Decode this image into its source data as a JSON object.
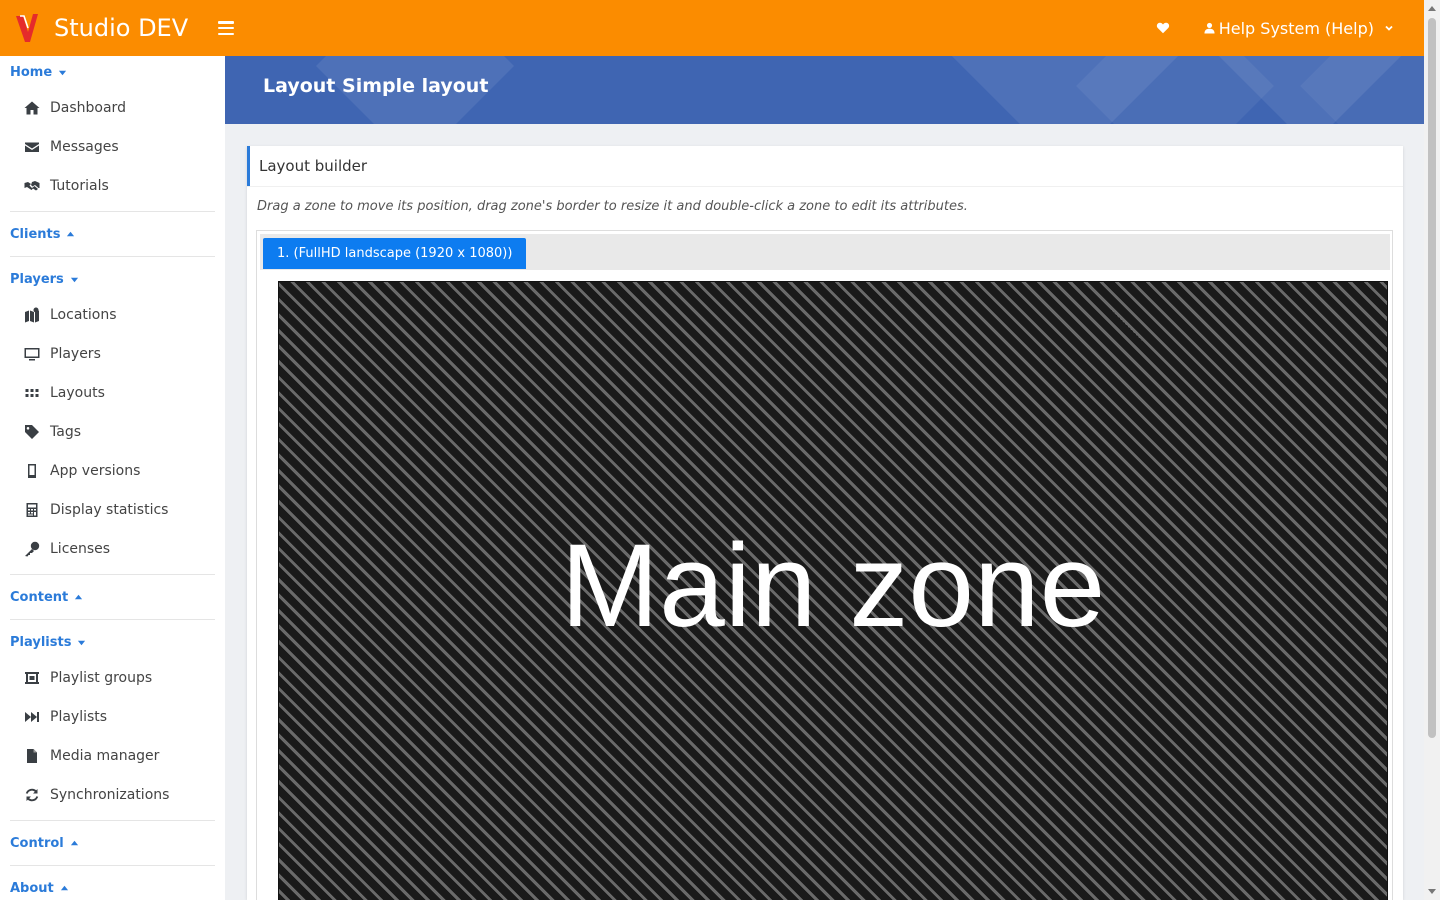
{
  "app": {
    "brand": "Studio DEV",
    "user": "Help System (Help)",
    "accent": "#fb8c00",
    "logo_color": "#e52b2b"
  },
  "sidebar": {
    "sections": [
      {
        "label": "Home",
        "expanded": true,
        "items": [
          {
            "label": "Dashboard",
            "icon": "home-icon"
          },
          {
            "label": "Messages",
            "icon": "envelope-icon"
          },
          {
            "label": "Tutorials",
            "icon": "handshake-icon"
          }
        ]
      },
      {
        "label": "Clients",
        "expanded": false,
        "items": []
      },
      {
        "label": "Players",
        "expanded": true,
        "items": [
          {
            "label": "Locations",
            "icon": "map-icon"
          },
          {
            "label": "Players",
            "icon": "monitor-icon"
          },
          {
            "label": "Layouts",
            "icon": "grid-icon"
          },
          {
            "label": "Tags",
            "icon": "tag-icon"
          },
          {
            "label": "App versions",
            "icon": "mobile-icon"
          },
          {
            "label": "Display statistics",
            "icon": "calculator-icon"
          },
          {
            "label": "Licenses",
            "icon": "key-icon"
          }
        ]
      },
      {
        "label": "Content",
        "expanded": false,
        "items": []
      },
      {
        "label": "Playlists",
        "expanded": true,
        "items": [
          {
            "label": "Playlist groups",
            "icon": "crop-icon"
          },
          {
            "label": "Playlists",
            "icon": "fast-forward-icon"
          },
          {
            "label": "Media manager",
            "icon": "file-icon"
          },
          {
            "label": "Synchronizations",
            "icon": "sync-icon"
          }
        ]
      },
      {
        "label": "Control",
        "expanded": false,
        "items": []
      },
      {
        "label": "About",
        "expanded": false,
        "items": []
      }
    ]
  },
  "page": {
    "title": "Layout Simple layout",
    "card_title": "Layout builder",
    "instructions": "Drag a zone to move its position, drag zone's border to resize it and double-click a zone to edit its attributes.",
    "tab_label": "1. (FullHD landscape (1920 x 1080))",
    "zone_label": "Main zone"
  }
}
